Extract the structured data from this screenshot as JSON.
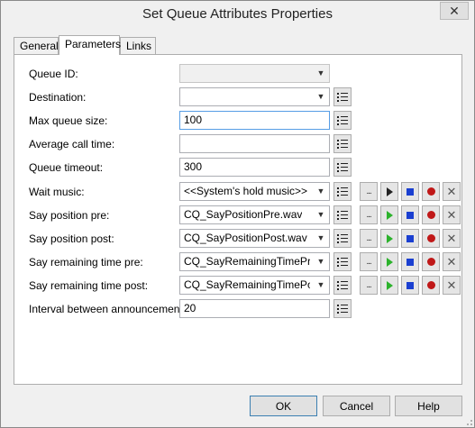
{
  "window": {
    "title": "Set Queue Attributes Properties"
  },
  "tabs": [
    {
      "label": "General"
    },
    {
      "label": "Parameters",
      "active": true
    },
    {
      "label": "Links"
    }
  ],
  "fields": {
    "queue_id": {
      "label": "Queue ID:",
      "value": ""
    },
    "destination": {
      "label": "Destination:",
      "value": ""
    },
    "max_queue_size": {
      "label": "Max queue size:",
      "value": "100"
    },
    "average_call_time": {
      "label": "Average call time:",
      "value": ""
    },
    "queue_timeout": {
      "label": "Queue timeout:",
      "value": "300"
    },
    "wait_music": {
      "label": "Wait music:",
      "value": "<<System's hold music>>"
    },
    "say_position_pre": {
      "label": "Say position pre:",
      "value": "CQ_SayPositionPre.wav"
    },
    "say_position_post": {
      "label": "Say position post:",
      "value": "CQ_SayPositionPost.wav"
    },
    "say_remaining_time_pre": {
      "label": "Say remaining time pre:",
      "value": "CQ_SayRemainingTimePre.wa"
    },
    "say_remaining_time_post": {
      "label": "Say remaining time post:",
      "value": "CQ_SayRemainingTimePost.wa"
    },
    "interval_between_announcements": {
      "label": "Interval between announcements:",
      "value": "20"
    }
  },
  "media_buttons": {
    "browse": "..."
  },
  "footer": {
    "ok": "OK",
    "cancel": "Cancel",
    "help": "Help"
  },
  "colors": {
    "play": "#2cb22c",
    "stop": "#1a3fd1",
    "record": "#c01818",
    "focus": "#569de5"
  }
}
